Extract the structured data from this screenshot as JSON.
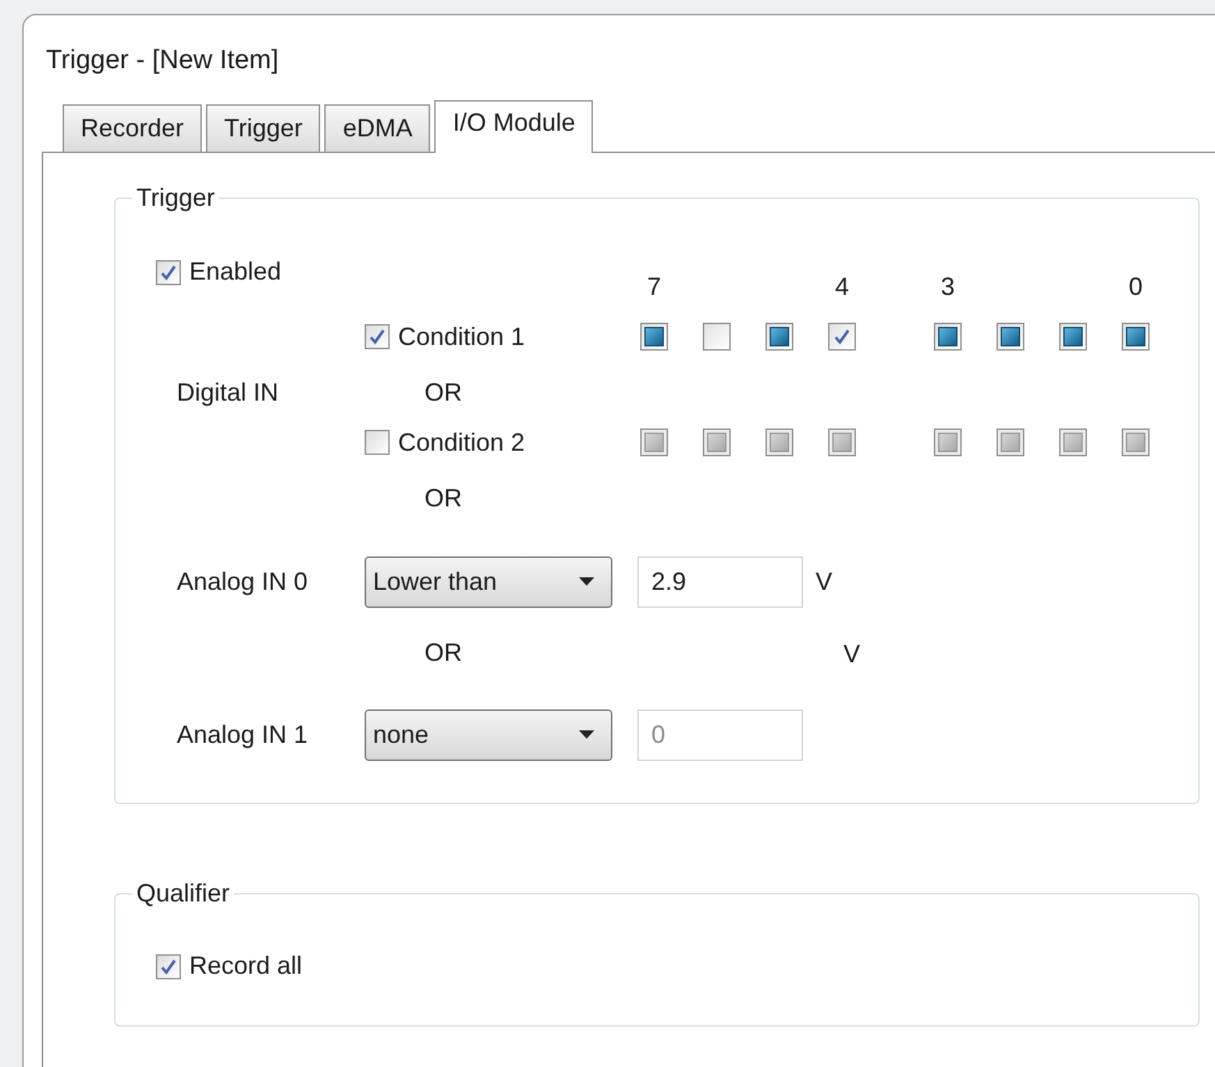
{
  "window": {
    "title": "Trigger - [New Item]"
  },
  "tabs": [
    {
      "label": "Recorder",
      "selected": false
    },
    {
      "label": "Trigger",
      "selected": false
    },
    {
      "label": "eDMA",
      "selected": false
    },
    {
      "label": "I/O Module",
      "selected": true
    }
  ],
  "trigger_group": {
    "title": "Trigger",
    "enabled": {
      "label": "Enabled",
      "checked": true
    },
    "bit_columns": [
      {
        "label": "7"
      },
      {},
      {},
      {
        "label": "4"
      },
      {
        "label": "3"
      },
      {},
      {},
      {
        "label": "0"
      }
    ],
    "digital_in": {
      "label": "Digital IN",
      "conditions": [
        {
          "label": "Condition 1",
          "checked": true,
          "or_label": "OR",
          "bits": [
            {
              "checked": false,
              "indeterminate": true
            },
            {
              "checked": false,
              "indeterminate": false
            },
            {
              "checked": false,
              "indeterminate": true
            },
            {
              "checked": true,
              "indeterminate": false
            },
            {
              "checked": false,
              "indeterminate": true
            },
            {
              "checked": false,
              "indeterminate": true
            },
            {
              "checked": false,
              "indeterminate": true
            },
            {
              "checked": false,
              "indeterminate": true
            }
          ]
        },
        {
          "label": "Condition 2",
          "checked": false,
          "or_label": "OR",
          "bits": [
            {
              "checked": false,
              "indeterminate": true
            },
            {
              "checked": false,
              "indeterminate": true
            },
            {
              "checked": false,
              "indeterminate": true
            },
            {
              "checked": false,
              "indeterminate": true
            },
            {
              "checked": false,
              "indeterminate": true
            },
            {
              "checked": false,
              "indeterminate": true
            },
            {
              "checked": false,
              "indeterminate": true
            },
            {
              "checked": false,
              "indeterminate": true
            }
          ]
        }
      ]
    },
    "analog_inputs": [
      {
        "label": "Analog IN 0",
        "mode": "Lower than",
        "value": "2.9",
        "disabled": false,
        "unit": "V",
        "or_label": "OR"
      },
      {
        "label": "Analog IN 1",
        "mode": "none",
        "value": "0",
        "disabled": true,
        "unit": "V"
      }
    ]
  },
  "qualifier_group": {
    "title": "Qualifier",
    "record_all": {
      "label": "Record all",
      "checked": true
    }
  }
}
